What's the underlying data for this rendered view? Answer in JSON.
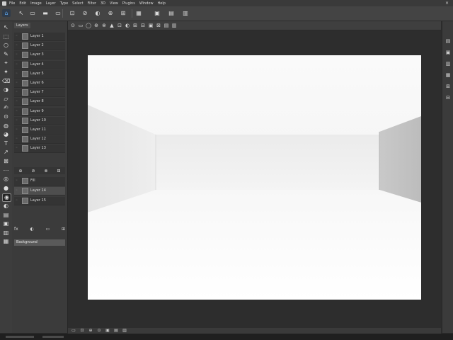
{
  "menubar": {
    "items": [
      "File",
      "Edit",
      "Image",
      "Layer",
      "Type",
      "Select",
      "Filter",
      "3D",
      "View",
      "Plugins",
      "Window",
      "Help"
    ],
    "close_glyph": "×"
  },
  "optionsbar": {
    "home_glyph": "⌂",
    "buttons": [
      "↖",
      "▭",
      "▬",
      "▭",
      "⊡",
      "⊘",
      "◐",
      "⊕",
      "⊞",
      "▦",
      "▣",
      "▤",
      "▥"
    ]
  },
  "toolbar": {
    "tools": [
      "↖",
      "⬚",
      "○",
      "✎",
      "⌖",
      "✦",
      "⌫",
      "◑",
      "▱",
      "✍",
      "⊙",
      "◍",
      "◕",
      "T",
      "↗",
      "⊠",
      "⋯",
      "◎",
      "●",
      "◉",
      "◐",
      "▤",
      "▣",
      "▥",
      "▦"
    ]
  },
  "panel": {
    "tab_label": "Layers",
    "rows": [
      {
        "label": "Layer 1"
      },
      {
        "label": "Layer 2"
      },
      {
        "label": "Layer 3"
      },
      {
        "label": "Layer 4"
      },
      {
        "label": "Layer 5"
      },
      {
        "label": "Layer 6"
      },
      {
        "label": "Layer 7"
      },
      {
        "label": "Layer 8"
      },
      {
        "label": "Layer 9"
      },
      {
        "label": "Layer 10"
      },
      {
        "label": "Layer 11"
      },
      {
        "label": "Layer 12"
      },
      {
        "label": "Layer 13"
      }
    ],
    "lower_rows": [
      {
        "label": "Fill"
      },
      {
        "label": "Layer 14"
      },
      {
        "label": "Layer 15"
      }
    ],
    "lower_bar_glyphs": [
      "⊕",
      "⊘",
      "⊗",
      "⊞"
    ],
    "small_icons": [
      "fx",
      "◐",
      "▭",
      "⊞"
    ],
    "status_label": "Background"
  },
  "doctoolbar": {
    "buttons": [
      "⊙",
      "▭",
      "◯",
      "⊕",
      "⊗",
      "▲",
      "⊡",
      "◐",
      "⊞",
      "⊟",
      "▣",
      "⊠",
      "▤",
      "▥"
    ]
  },
  "rightdock": {
    "icons": [
      "▤",
      "▣",
      "▥",
      "▦",
      "⊞",
      "⊟"
    ]
  },
  "statusbar": {
    "buttons": [
      "▭",
      "⊡",
      "⊕",
      "⊙",
      "▣",
      "▤",
      "▥"
    ]
  },
  "colors": {
    "accent": "#5aa1e6",
    "canvas": "#fdfdfd",
    "workspace": "#2d2d2d"
  }
}
